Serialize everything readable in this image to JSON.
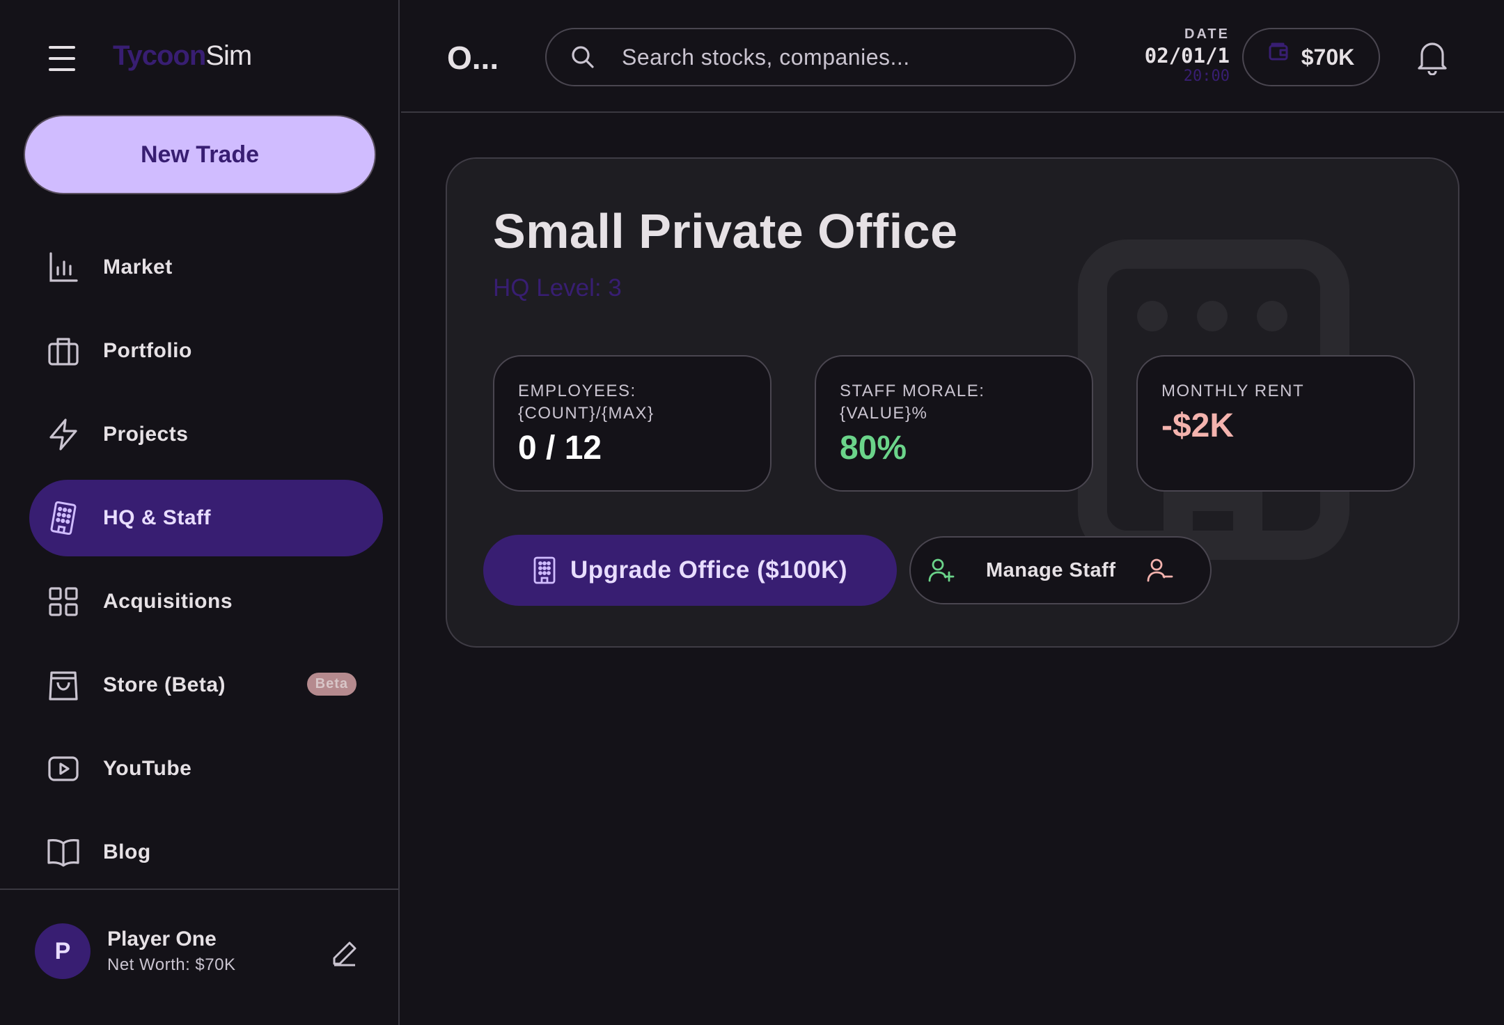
{
  "brand": {
    "part1": "Tycoon",
    "part2": "Sim"
  },
  "sidebar": {
    "new_trade_label": "New Trade",
    "items": [
      {
        "label": "Market",
        "icon": "bar-chart-icon"
      },
      {
        "label": "Portfolio",
        "icon": "briefcase-icon"
      },
      {
        "label": "Projects",
        "icon": "lightning-icon"
      },
      {
        "label": "HQ & Staff",
        "icon": "building-icon",
        "active": true
      },
      {
        "label": "Acquisitions",
        "icon": "grid-icon"
      },
      {
        "label": "Store (Beta)",
        "icon": "shopping-bag-icon",
        "badge": "Beta"
      },
      {
        "label": "YouTube",
        "icon": "play-icon"
      },
      {
        "label": "Blog",
        "icon": "book-icon"
      }
    ],
    "player": {
      "initial": "P",
      "name": "Player One",
      "net_worth": "Net Worth: $70K"
    }
  },
  "header": {
    "title": "O...",
    "search_placeholder": "Search stocks, companies...",
    "date_label": "DATE",
    "date_value": "02/01/1",
    "time_value": "20:00",
    "cash": "$70K"
  },
  "office": {
    "title": "Small Private Office",
    "hq_level": "HQ Level: 3",
    "stats": [
      {
        "label": "EMPLOYEES:\n{COUNT}/{MAX}",
        "value": "0 / 12",
        "color": "#ffffff"
      },
      {
        "label": "STAFF MORALE:\n{VALUE}%",
        "value": "80%",
        "color": "#6bd48a"
      },
      {
        "label": "MONTHLY RENT",
        "value": "-$2K",
        "color": "#f4b3ae"
      }
    ],
    "upgrade_label": "Upgrade Office ($100K)",
    "manage_label": "Manage Staff"
  },
  "colors": {
    "accent": "#d0bcff",
    "primary_dark": "#381e72",
    "positive": "#6bd48a",
    "negative": "#f4b3ae"
  }
}
